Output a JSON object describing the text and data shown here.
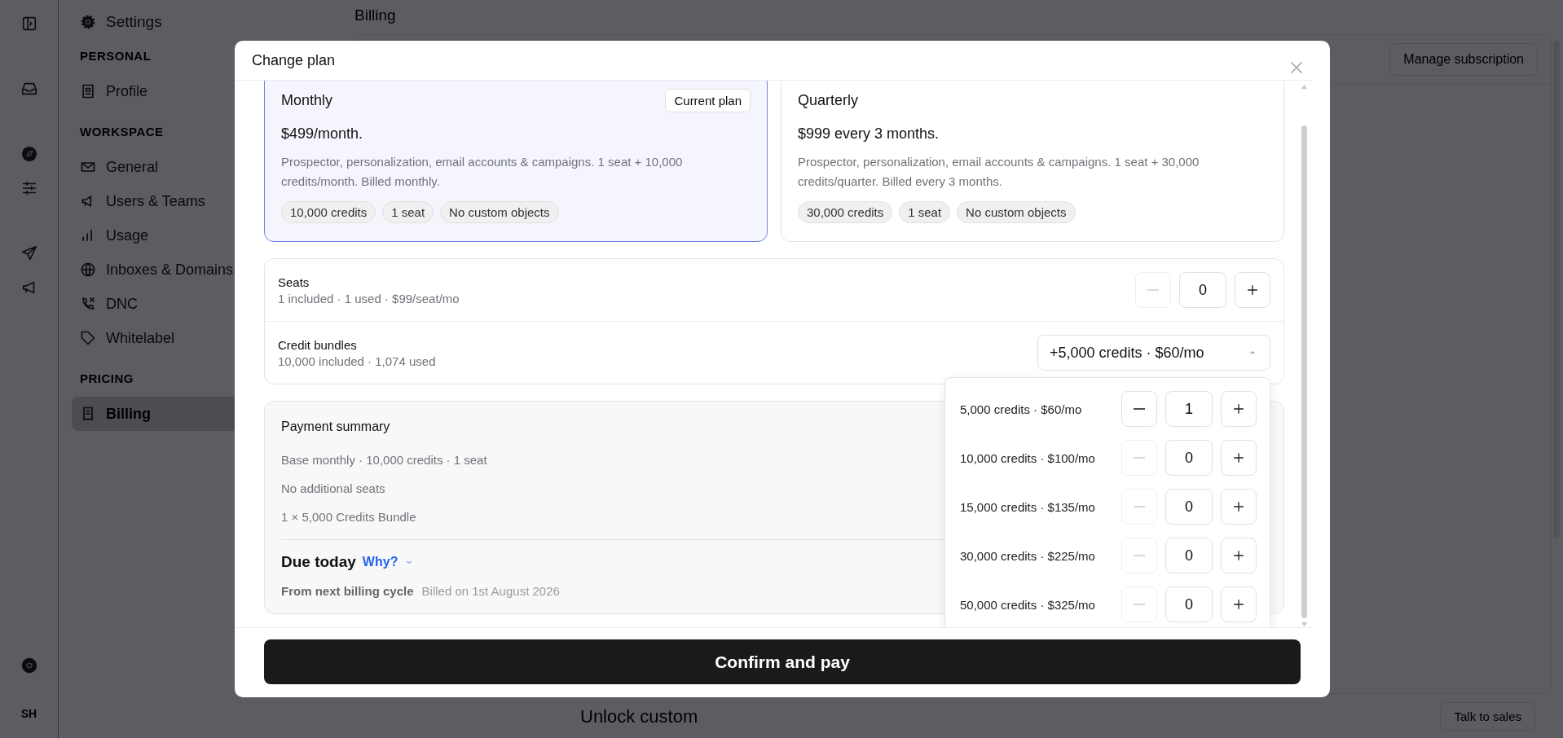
{
  "icon_rail": {
    "avatar_initials": "SH"
  },
  "sidebar": {
    "title": "Settings",
    "sections": [
      {
        "heading": "PERSONAL",
        "items": [
          {
            "label": "Profile",
            "selected": false
          }
        ]
      },
      {
        "heading": "WORKSPACE",
        "items": [
          {
            "label": "General",
            "selected": false
          },
          {
            "label": "Users & Teams",
            "selected": false
          },
          {
            "label": "Usage",
            "selected": false
          },
          {
            "label": "Inboxes & Domains",
            "selected": false
          },
          {
            "label": "DNC",
            "selected": false
          },
          {
            "label": "Whitelabel",
            "selected": false
          }
        ]
      },
      {
        "heading": "PRICING",
        "items": [
          {
            "label": "Billing",
            "selected": true
          }
        ]
      }
    ]
  },
  "page": {
    "title": "Billing",
    "manage_button": "Manage subscription",
    "unlock_heading": "Unlock custom",
    "talk_button": "Talk to sales"
  },
  "modal": {
    "title": "Change plan",
    "plans": [
      {
        "name": "Monthly",
        "badge": "Current plan",
        "price": "$499/month.",
        "description": "Prospector, personalization, email accounts & campaigns. 1 seat + 10,000 credits/month. Billed monthly.",
        "tags": [
          "10,000 credits",
          "1 seat",
          "No custom objects"
        ],
        "selected": true
      },
      {
        "name": "Quarterly",
        "price": "$999 every 3 months.",
        "description": "Prospector, personalization, email accounts & campaigns. 1 seat + 30,000 credits/quarter. Billed every 3 months.",
        "tags": [
          "30,000 credits",
          "1 seat",
          "No custom objects"
        ],
        "selected": false
      }
    ],
    "seats": {
      "label": "Seats",
      "detail": "1 included · 1 used · $99/seat/mo",
      "value": "0",
      "minus_disabled": true
    },
    "credit_bundles": {
      "label": "Credit bundles",
      "detail": "10,000 included · 1,074 used",
      "dropdown_value": "+5,000 credits · $60/mo",
      "expanded": true,
      "options": [
        {
          "label": "5,000 credits · $60/mo",
          "value": "1",
          "minus_disabled": false
        },
        {
          "label": "10,000 credits · $100/mo",
          "value": "0",
          "minus_disabled": true
        },
        {
          "label": "15,000 credits · $135/mo",
          "value": "0",
          "minus_disabled": true
        },
        {
          "label": "30,000 credits · $225/mo",
          "value": "0",
          "minus_disabled": true
        },
        {
          "label": "50,000 credits · $325/mo",
          "value": "0",
          "minus_disabled": true
        }
      ]
    },
    "payment_summary": {
      "title": "Payment summary",
      "lines": [
        "Base monthly · 10,000 credits · 1 seat",
        "No additional seats",
        "1 × 5,000 Credits Bundle"
      ],
      "due_label": "Due today",
      "why_link": "Why?",
      "next_cycle_label": "From next billing cycle",
      "next_cycle_date": "Billed on 1st August 2026"
    },
    "confirm_button": "Confirm and pay"
  }
}
